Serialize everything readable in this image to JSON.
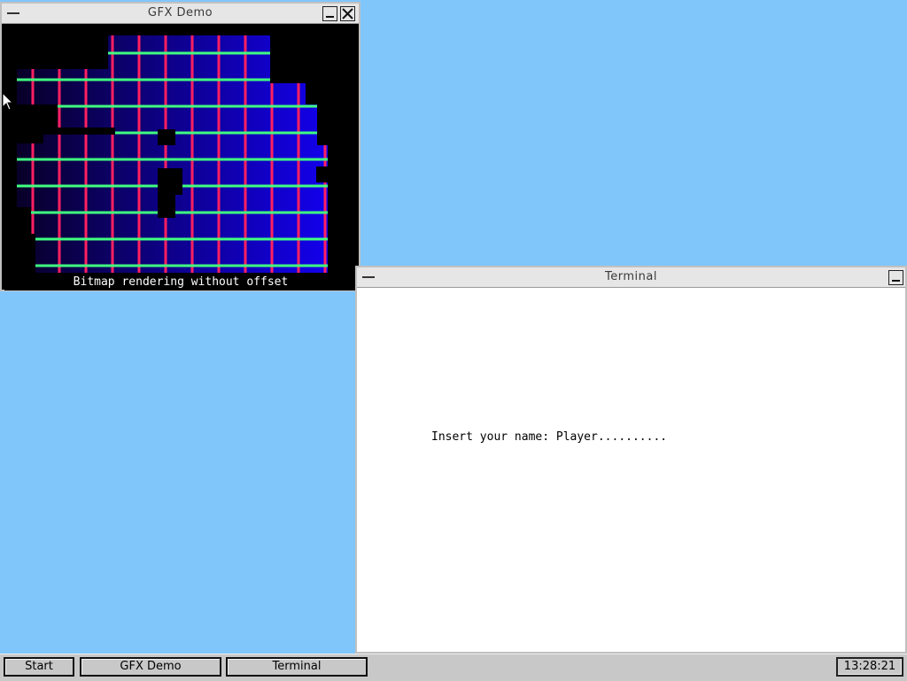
{
  "gfx_window": {
    "title": "GFX Demo",
    "caption": "Bitmap rendering without offset"
  },
  "terminal_window": {
    "title": "Terminal",
    "prompt_line": "Insert your name: Player.........."
  },
  "taskbar": {
    "start_label": "Start",
    "tasks": [
      "GFX Demo",
      "Terminal"
    ],
    "clock": "13:28:21"
  },
  "colors": {
    "desktop": "#80c6fb",
    "gradient_start": "#080020",
    "gradient_end": "#1400ff",
    "vertical_lines": "#ff2060",
    "horizontal_lines": "#40ff80"
  }
}
